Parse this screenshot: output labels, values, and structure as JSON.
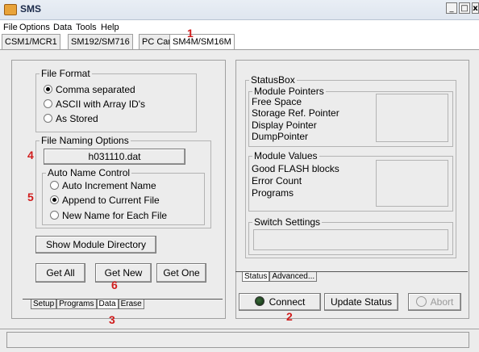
{
  "window": {
    "title": "SMS",
    "minimize": "_",
    "maximize": "□",
    "close": "x"
  },
  "menu": [
    "File",
    "Options",
    "Data",
    "Tools",
    "Help"
  ],
  "top_tabs": [
    "CSM1/MCR1",
    "SM192/SM716",
    "PC Card",
    "SM4M/SM16M"
  ],
  "left": {
    "file_format": {
      "legend": "File Format",
      "options": [
        {
          "label": "Comma separated",
          "selected": true
        },
        {
          "label": "ASCII with Array ID's",
          "selected": false
        },
        {
          "label": "As Stored",
          "selected": false
        }
      ]
    },
    "file_naming": {
      "legend": "File Naming Options",
      "filename_button": "h031110.dat",
      "auto_name": {
        "legend": "Auto Name Control",
        "options": [
          {
            "label": "Auto Increment Name",
            "selected": false
          },
          {
            "label": "Append to Current File",
            "selected": true
          },
          {
            "label": "New Name for Each File",
            "selected": false
          }
        ]
      }
    },
    "show_directory_button": "Show Module Directory",
    "get_all_button": "Get All",
    "get_new_button": "Get New",
    "get_one_button": "Get One",
    "bottom_tabs": [
      "Setup",
      "Programs",
      "Data",
      "Erase"
    ]
  },
  "right": {
    "statusbox_legend": "StatusBox",
    "module_pointers": {
      "legend": "Module Pointers",
      "items": [
        "Free Space",
        "Storage Ref. Pointer",
        "Display Pointer",
        "DumpPointer"
      ]
    },
    "module_values": {
      "legend": "Module Values",
      "items": [
        "Good FLASH blocks",
        "Error Count",
        "Programs"
      ]
    },
    "switch_settings_legend": "Switch Settings",
    "bottom_tabs": [
      "Status",
      "Advanced..."
    ],
    "connect_button": "Connect",
    "update_status_button": "Update Status",
    "abort_button": "Abort"
  },
  "annotations": [
    "1",
    "2",
    "3",
    "4",
    "5",
    "6"
  ],
  "colors": {
    "annotation": "#d01c1c",
    "panel": "#ececec"
  }
}
